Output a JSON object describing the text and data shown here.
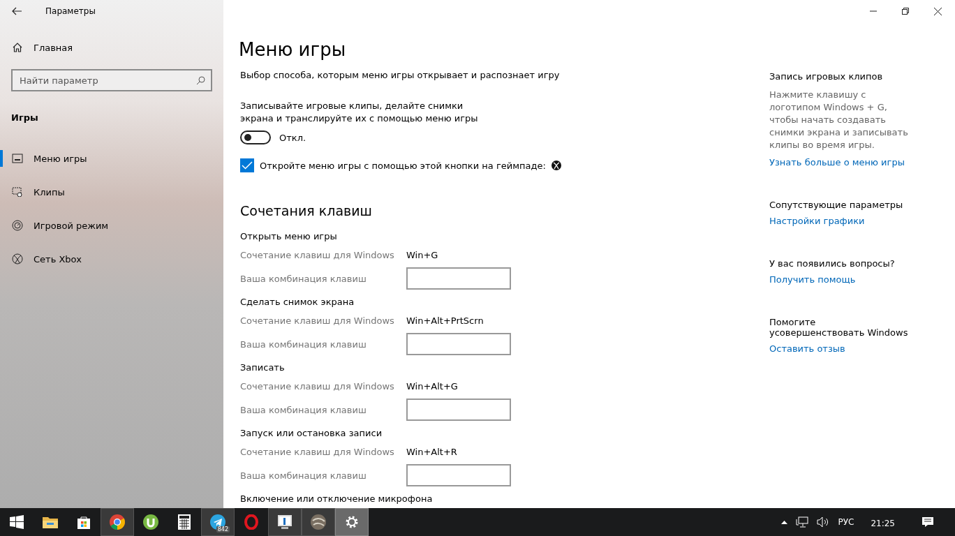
{
  "window": {
    "title": "Параметры"
  },
  "sidebar": {
    "home": "Главная",
    "search": {
      "placeholder": "Найти параметр"
    },
    "section": "Игры",
    "items": [
      {
        "label": "Меню игры",
        "selected": true
      },
      {
        "label": "Клипы",
        "selected": false
      },
      {
        "label": "Игровой режим",
        "selected": false
      },
      {
        "label": "Сеть Xbox",
        "selected": false
      }
    ]
  },
  "main": {
    "title": "Меню игры",
    "subtitle": "Выбор способа, которым меню игры открывает и распознает игру",
    "toggle": {
      "label": "Записывайте игровые клипы, делайте снимки экрана и транслируйте их с помощью меню игры",
      "on": false,
      "state": "Откл."
    },
    "checkbox": {
      "label": "Откройте меню игры с помощью этой кнопки на геймпаде:",
      "checked": true
    },
    "shortcuts_title": "Сочетания клавиш",
    "shortcuts": [
      {
        "name": "Открыть меню игры",
        "win_label": "Сочетание клавиш для Windows",
        "win_keys": "Win+G",
        "custom_label": "Ваша комбинация клавиш"
      },
      {
        "name": "Сделать снимок экрана",
        "win_label": "Сочетание клавиш для Windows",
        "win_keys": "Win+Alt+PrtScrn",
        "custom_label": "Ваша комбинация клавиш"
      },
      {
        "name": "Записать",
        "win_label": "Сочетание клавиш для Windows",
        "win_keys": "Win+Alt+G",
        "custom_label": "Ваша комбинация клавиш"
      },
      {
        "name": "Запуск или остановка записи",
        "win_label": "Сочетание клавиш для Windows",
        "win_keys": "Win+Alt+R",
        "custom_label": "Ваша комбинация клавиш"
      }
    ],
    "cut_heading": "Включение или отключение микрофона"
  },
  "aside": [
    {
      "title": "Запись игровых клипов",
      "text": "Нажмите клавишу с логотипом Windows + G, чтобы начать создавать снимки экрана и записывать клипы во время игры.",
      "link": "Узнать больше о меню игры"
    },
    {
      "title": "Сопутствующие параметры",
      "link": "Настройки графики"
    },
    {
      "title": "У вас появились вопросы?",
      "link": "Получить помощь"
    },
    {
      "title": "Помогите усовершенствовать Windows",
      "link": "Оставить отзыв"
    }
  ],
  "taskbar": {
    "apps": [
      {
        "kind": "start",
        "running": false,
        "selected": false
      },
      {
        "kind": "explorer",
        "running": false,
        "selected": false
      },
      {
        "kind": "store",
        "running": false,
        "selected": false
      },
      {
        "kind": "chrome",
        "running": true,
        "selected": false
      },
      {
        "kind": "torrent",
        "running": false,
        "selected": false
      },
      {
        "kind": "calculator",
        "running": false,
        "selected": false
      },
      {
        "kind": "telegram",
        "running": true,
        "selected": false,
        "badge": "842"
      },
      {
        "kind": "opera",
        "running": false,
        "selected": false
      },
      {
        "kind": "monitor",
        "running": true,
        "selected": false
      },
      {
        "kind": "sphere",
        "running": true,
        "selected": false
      },
      {
        "kind": "settings",
        "running": true,
        "selected": true
      }
    ],
    "language": "РУС",
    "time": "21:25"
  }
}
